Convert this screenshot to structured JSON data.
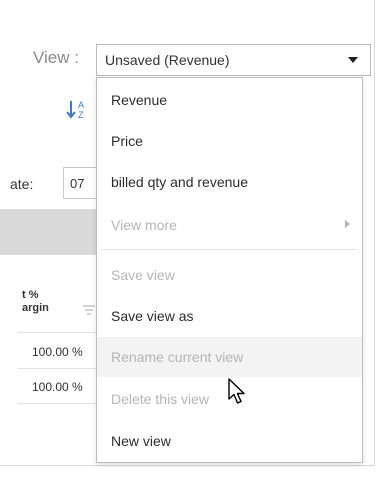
{
  "view": {
    "label": "View :",
    "selected": "Unsaved (Revenue)"
  },
  "filters": {
    "date_label": "ate:",
    "date_value": "07"
  },
  "table": {
    "column_header_line1": "t %",
    "column_header_line2": "argin",
    "rows": [
      "100.00 %",
      "100.00 %"
    ]
  },
  "menu": {
    "items": [
      {
        "label": "Revenue",
        "disabled": false
      },
      {
        "label": "Price",
        "disabled": false
      },
      {
        "label": "billed qty and revenue",
        "disabled": false
      },
      {
        "label": "View more",
        "disabled": true
      },
      {
        "label": "Save view",
        "disabled": true
      },
      {
        "label": "Save view as",
        "disabled": false
      },
      {
        "label": "Rename current view",
        "disabled": true
      },
      {
        "label": "Delete this view",
        "disabled": true
      },
      {
        "label": "New view",
        "disabled": false
      }
    ]
  },
  "icons": {
    "sort": "sort-az-icon",
    "dropdown": "caret-down-icon",
    "submenu": "chevron-right-icon",
    "filter": "filter-icon",
    "cursor": "mouse-pointer-icon"
  },
  "colors": {
    "accent": "#3a7bd5",
    "disabled_text": "#b5b5b5",
    "hover_row": "#f3f3f3"
  }
}
